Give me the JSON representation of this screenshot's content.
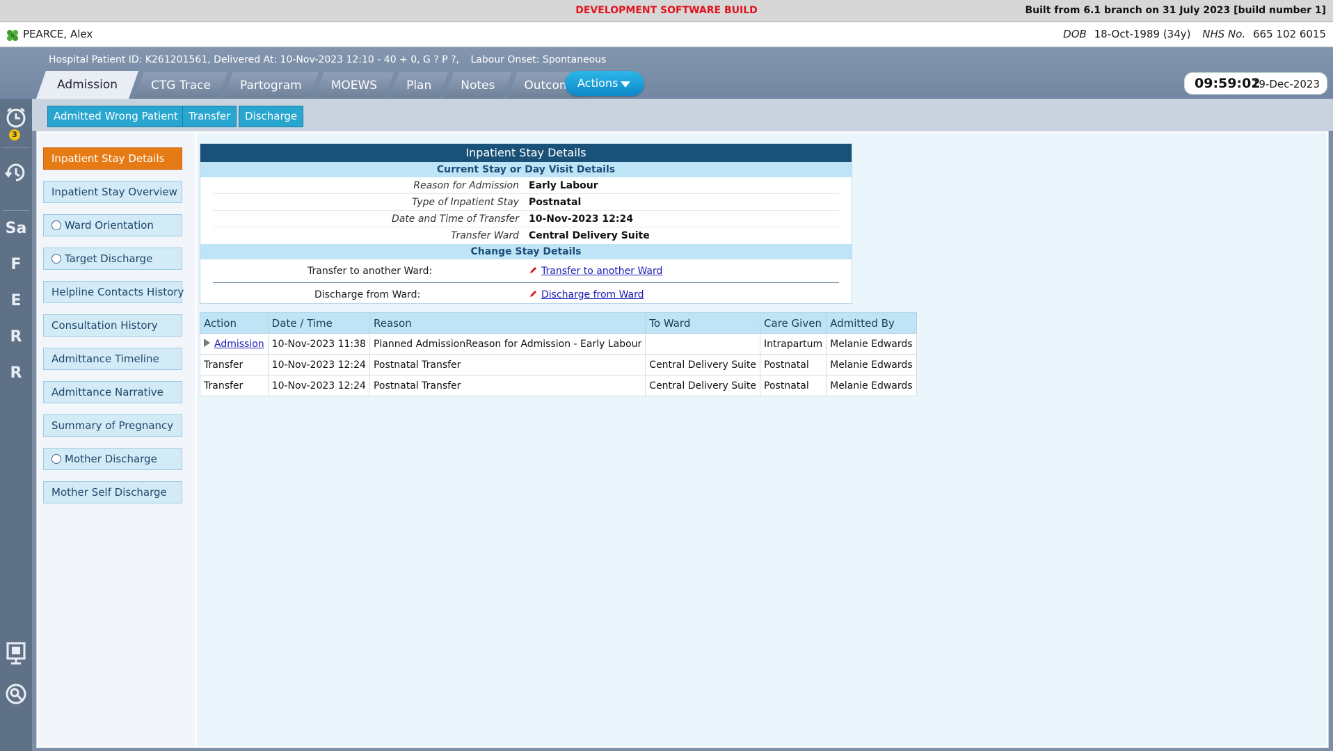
{
  "build_bar": {
    "center": "DEVELOPMENT SOFTWARE BUILD",
    "right": "Built from 6.1 branch on 31 July 2023 [build number 1]"
  },
  "patient": {
    "name": "PEARCE, Alex",
    "dob_label": "DOB",
    "dob_value": "18-Oct-1989 (34y)",
    "nhs_label": "NHS No.",
    "nhs_value": "665 102 6015",
    "info": "Hospital Patient ID: K261201561, Delivered At: 10-Nov-2023 12:10 - 40 + 0, G ? P ?,",
    "labour_onset": "Labour Onset: Spontaneous"
  },
  "tabs": [
    {
      "label": "Admission",
      "active": true
    },
    {
      "label": "CTG Trace"
    },
    {
      "label": "Partogram"
    },
    {
      "label": "MOEWS"
    },
    {
      "label": "Plan"
    },
    {
      "label": "Notes"
    },
    {
      "label": "Outcome"
    }
  ],
  "actions_label": "Actions",
  "clock": {
    "time": "09:59:02",
    "date": "19-Dec-2023"
  },
  "rail": {
    "alarm_count": "3",
    "letters": [
      "Sa",
      "F",
      "E",
      "R",
      "R"
    ]
  },
  "action_buttons": [
    "Admitted Wrong Patient",
    "Transfer",
    "Discharge"
  ],
  "nav": [
    {
      "label": "Inpatient Stay Details",
      "active": true
    },
    {
      "label": "Inpatient Stay Overview"
    },
    {
      "label": "Ward Orientation",
      "radio": true
    },
    {
      "label": "Target Discharge",
      "radio": true
    },
    {
      "label": "Helpline Contacts History"
    },
    {
      "label": "Consultation History"
    },
    {
      "label": "Admittance Timeline"
    },
    {
      "label": "Admittance Narrative"
    },
    {
      "label": "Summary of Pregnancy"
    },
    {
      "label": "Mother Discharge",
      "radio": true
    },
    {
      "label": "Mother Self Discharge"
    }
  ],
  "details": {
    "title": "Inpatient Stay Details",
    "current_header": "Current Stay or Day Visit Details",
    "rows": [
      {
        "label": "Reason for Admission",
        "value": "Early Labour"
      },
      {
        "label": "Type of Inpatient Stay",
        "value": "Postnatal"
      },
      {
        "label": "Date and Time of Transfer",
        "value": "10-Nov-2023 12:24"
      },
      {
        "label": "Transfer Ward",
        "value": "Central Delivery Suite"
      }
    ],
    "change_header": "Change Stay Details",
    "change_rows": [
      {
        "label": "Transfer to another Ward:",
        "link": "Transfer to another Ward"
      },
      {
        "label": "Discharge from Ward:",
        "link": "Discharge from Ward"
      }
    ]
  },
  "history": {
    "headers": [
      "Action",
      "Date / Time",
      "Reason",
      "To Ward",
      "Care Given",
      "Admitted By"
    ],
    "rows": [
      [
        "Admission",
        "10-Nov-2023 11:38",
        "Planned AdmissionReason for Admission - Early Labour",
        "",
        "Intrapartum",
        "Melanie Edwards"
      ],
      [
        "Transfer",
        "10-Nov-2023 12:24",
        "Postnatal Transfer",
        "Central Delivery Suite",
        "Postnatal",
        "Melanie Edwards"
      ],
      [
        "Transfer",
        "10-Nov-2023 12:24",
        "Postnatal Transfer",
        "Central Delivery Suite",
        "Postnatal",
        "Melanie Edwards"
      ]
    ]
  },
  "colors": {
    "active_nav": "#e67a14",
    "header_blue": "#195178",
    "button_blue": "#28a6d0"
  }
}
